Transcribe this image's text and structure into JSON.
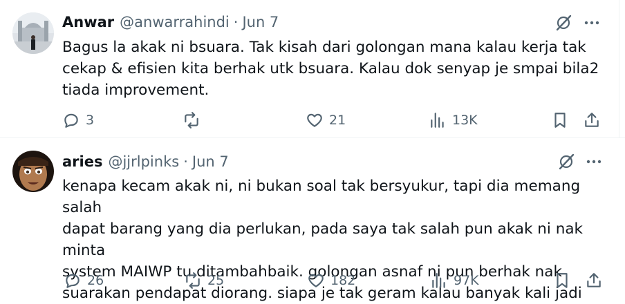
{
  "tweets": [
    {
      "author_name": "Anwar",
      "handle": "@anwarrahindi",
      "separator": "·",
      "date": "Jun 7",
      "text_lines": [
        "Bagus la akak ni bsuara. Tak kisah dari golongan mana kalau kerja tak",
        "cekap & efisien kita berhak utk bsuara. Kalau dok senyap je smpai bila2",
        "tiada improvement."
      ],
      "replies": "3",
      "reposts": "",
      "likes": "21",
      "views": "13K"
    },
    {
      "author_name": "aries",
      "handle": "@jjrlpinks",
      "separator": "·",
      "date": "Jun 7",
      "text_lines": [
        "kenapa kecam akak ni, ni bukan soal tak bersyukur, tapi dia memang salah",
        "dapat barang yang dia perlukan, pada saya tak salah pun akak ni nak minta",
        "system MAIWP tu ditambahbaik. golongan asnaf ni pun berhak nak",
        "suarakan pendapat diorang. siapa je tak geram kalau banyak kali jadi"
      ],
      "replies": "26",
      "reposts": "25",
      "likes": "182",
      "views": "97K"
    }
  ],
  "icons": {
    "grok": "grok-icon",
    "more": "more-icon",
    "reply": "reply-icon",
    "repost": "repost-icon",
    "like": "like-icon",
    "views": "views-icon",
    "bookmark": "bookmark-icon",
    "share": "share-icon"
  },
  "colors": {
    "text": "#0f1419",
    "muted": "#536471",
    "divider": "#eff3f4"
  }
}
